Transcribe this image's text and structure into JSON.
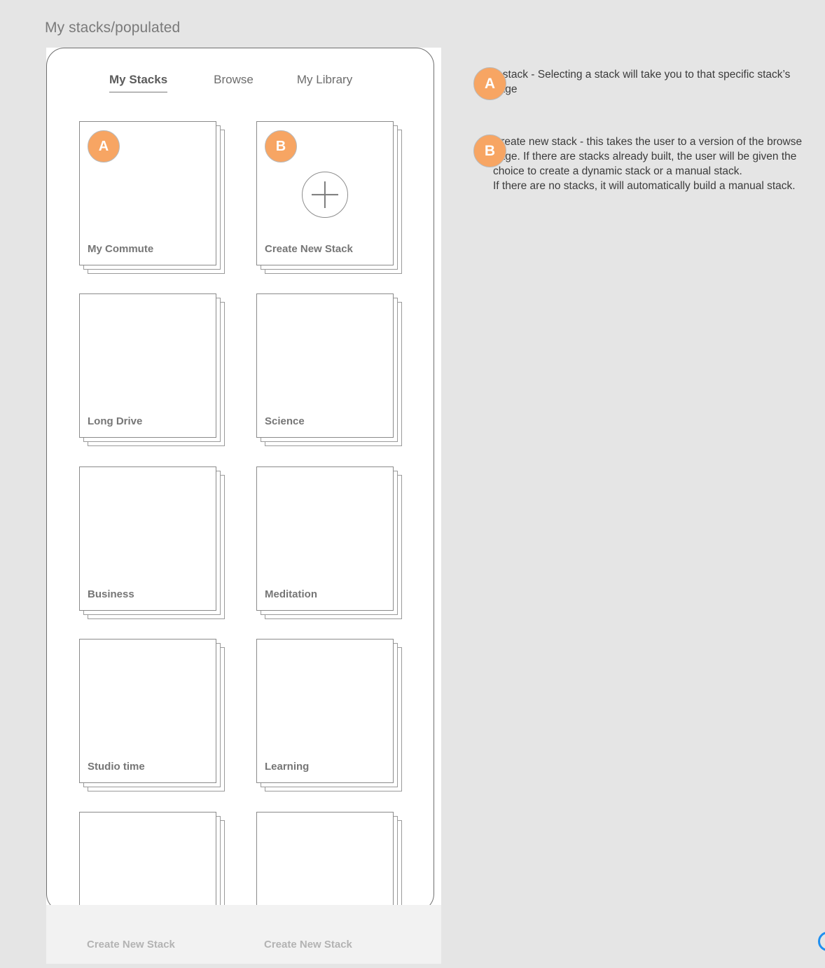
{
  "page": {
    "title": "My stacks/populated",
    "accent_color": "#f7a563",
    "background_color": "#e5e5e5"
  },
  "phone": {
    "tabs": [
      {
        "label": "My Stacks",
        "active": true
      },
      {
        "label": "Browse",
        "active": false
      },
      {
        "label": "My Library",
        "active": false
      }
    ],
    "stacks": [
      {
        "label": "My Commute",
        "badge": "A",
        "icon": ""
      },
      {
        "label": "Create New Stack",
        "badge": "B",
        "icon": "plus-icon"
      },
      {
        "label": "Long Drive",
        "badge": "",
        "icon": ""
      },
      {
        "label": "Science",
        "badge": "",
        "icon": ""
      },
      {
        "label": "Business",
        "badge": "",
        "icon": ""
      },
      {
        "label": "Meditation",
        "badge": "",
        "icon": ""
      },
      {
        "label": "Studio time",
        "badge": "",
        "icon": ""
      },
      {
        "label": "Learning",
        "badge": "",
        "icon": ""
      },
      {
        "label": "Create New Stack",
        "badge": "",
        "icon": ""
      },
      {
        "label": "Create New Stack",
        "badge": "",
        "icon": ""
      }
    ]
  },
  "annotations": [
    {
      "badge": "A",
      "text": "A stack - Selecting a stack will take you to that specific stack’s page"
    },
    {
      "badge": "B",
      "text": "Create new stack - this takes the user to a version of the browse page.  If there are stacks already built, the user will be given the choice to create a dynamic stack or a manual stack.\nIf there are no stacks, it will automatically build a manual stack."
    }
  ]
}
